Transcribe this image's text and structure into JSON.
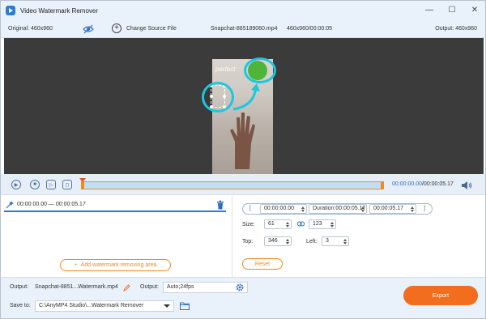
{
  "app": {
    "title": "Video Watermark Remover"
  },
  "window_controls": {
    "minimize": "—",
    "maximize": "☐",
    "close": "✕"
  },
  "infobar": {
    "original": "Original: 460x960",
    "change_source": "Change Source File",
    "filename": "Snapchat-885189060.mp4",
    "dims_time": "460x960/00:00:05",
    "output": "Output: 460x960"
  },
  "preview": {
    "watermark_text": "perfect"
  },
  "playback": {
    "current_time": "00:00:00.00",
    "total_time": "/00:00:05.17",
    "progress": 0.0
  },
  "clip": {
    "range": "00:00:00.00 — 00:00:05.17"
  },
  "add_area_label": "Add watermark removing area",
  "params": {
    "start": "00:00:00.00",
    "duration": "Duration:00:00:05.17",
    "end": "00:00:05.17",
    "size_label": "Size:",
    "width": "61",
    "height": "123",
    "top_label": "Top:",
    "top": "346",
    "left_label": "Left:",
    "left": "3",
    "reset": "Reset"
  },
  "bottom": {
    "output_label": "Output:",
    "output_file": "Snapchat-8851...Watermark.mp4",
    "format_label": "Output:",
    "format_value": "Auto;24fps",
    "save_label": "Save to:",
    "save_path": "C:\\AnyMP4 Studio\\...Watermark Remover",
    "export": "Export"
  },
  "colors": {
    "accent": "#f36d1f",
    "blue": "#2e7bd6",
    "highlight": "#19c8e0"
  }
}
